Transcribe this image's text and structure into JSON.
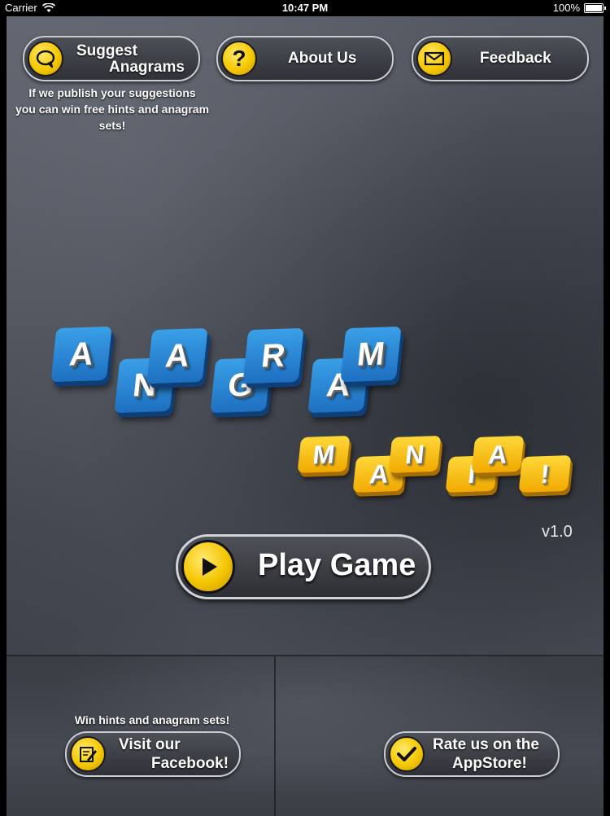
{
  "status_bar": {
    "carrier": "Carrier",
    "time": "10:47 PM",
    "battery": "100%"
  },
  "top_buttons": {
    "suggest": {
      "line1": "Suggest",
      "line2": "Anagrams"
    },
    "about": {
      "label": "About Us"
    },
    "feedback": {
      "label": "Feedback"
    }
  },
  "suggest_hint": {
    "line1": "If we publish your suggestions",
    "line2": "you can win free hints and anagram",
    "line3": "sets!"
  },
  "logo": {
    "word1": [
      "A",
      "N",
      "A",
      "G",
      "R",
      "A",
      "M"
    ],
    "word2": [
      "M",
      "A",
      "N",
      "I",
      "A",
      "!"
    ]
  },
  "version": "v1.0",
  "play": {
    "label": "Play Game"
  },
  "facebook": {
    "hint": "Win hints and anagram sets!",
    "line1": "Visit our",
    "line2": "Facebook!"
  },
  "rate": {
    "line1": "Rate us on the",
    "line2": "AppStore!"
  },
  "colors": {
    "accent_yellow": "#f5c800",
    "tile_blue": "#2a86d6",
    "tile_yellow": "#f8c21a"
  },
  "icons": {
    "suggest": "speech-bubble-icon",
    "about": "question-mark-icon",
    "feedback": "envelope-icon",
    "play": "play-triangle-icon",
    "facebook": "notepad-pencil-icon",
    "rate": "checkmark-icon"
  }
}
